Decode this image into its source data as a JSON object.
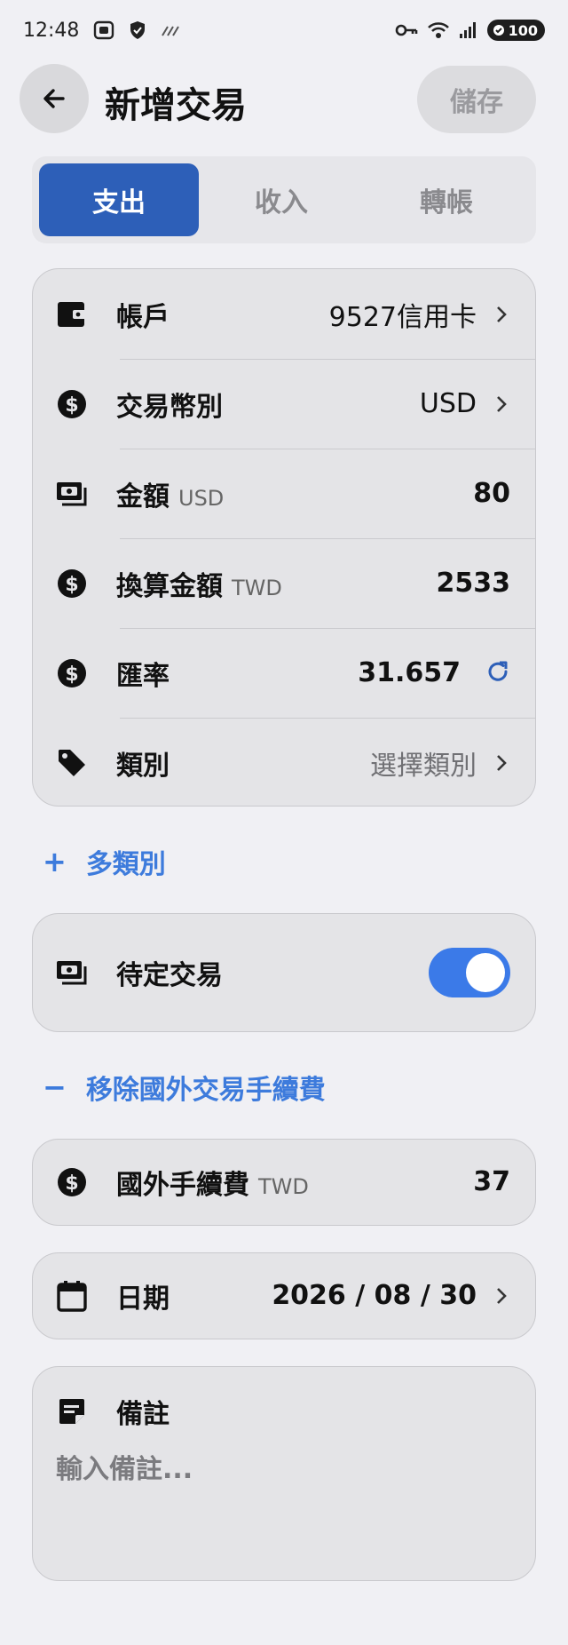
{
  "status_bar": {
    "time": "12:48",
    "battery": "100",
    "icons": [
      "screenshot-icon",
      "shield-icon",
      "signal-slash-icon",
      "key-icon",
      "wifi-icon",
      "cell-signal-icon",
      "battery-icon"
    ]
  },
  "header": {
    "title": "新增交易",
    "save_label": "儲存"
  },
  "tabs": [
    {
      "label": "支出",
      "active": true
    },
    {
      "label": "收入",
      "active": false
    },
    {
      "label": "轉帳",
      "active": false
    }
  ],
  "details": {
    "account": {
      "label": "帳戶",
      "value": "9527信用卡",
      "icon": "wallet-icon"
    },
    "currency": {
      "label": "交易幣別",
      "value": "USD",
      "icon": "dollar-circle-icon"
    },
    "amount": {
      "label": "金額",
      "unit": "USD",
      "value": "80",
      "icon": "cash-icon"
    },
    "converted": {
      "label": "換算金額",
      "unit": "TWD",
      "value": "2533",
      "icon": "dollar-circle-icon"
    },
    "rate": {
      "label": "匯率",
      "value": "31.657",
      "icon": "dollar-circle-icon"
    },
    "category": {
      "label": "類別",
      "value": "選擇類別",
      "icon": "tag-icon"
    }
  },
  "multi_category": {
    "symbol": "+",
    "label": "多類別"
  },
  "pending": {
    "label": "待定交易",
    "enabled": true,
    "icon": "cash-icon"
  },
  "remove_fee": {
    "symbol": "−",
    "label": "移除國外交易手續費"
  },
  "fee": {
    "label": "國外手續費",
    "unit": "TWD",
    "value": "37",
    "icon": "dollar-circle-icon"
  },
  "date": {
    "label": "日期",
    "value": "2026 / 08 / 30",
    "icon": "calendar-icon"
  },
  "memo": {
    "label": "備註",
    "placeholder": "輸入備註...",
    "icon": "note-icon"
  },
  "colors": {
    "accent": "#2d5fb8",
    "link": "#3d7bdc",
    "toggle_on": "#3b7ae8",
    "background": "#f0f0f4",
    "card": "#e4e4e7"
  }
}
